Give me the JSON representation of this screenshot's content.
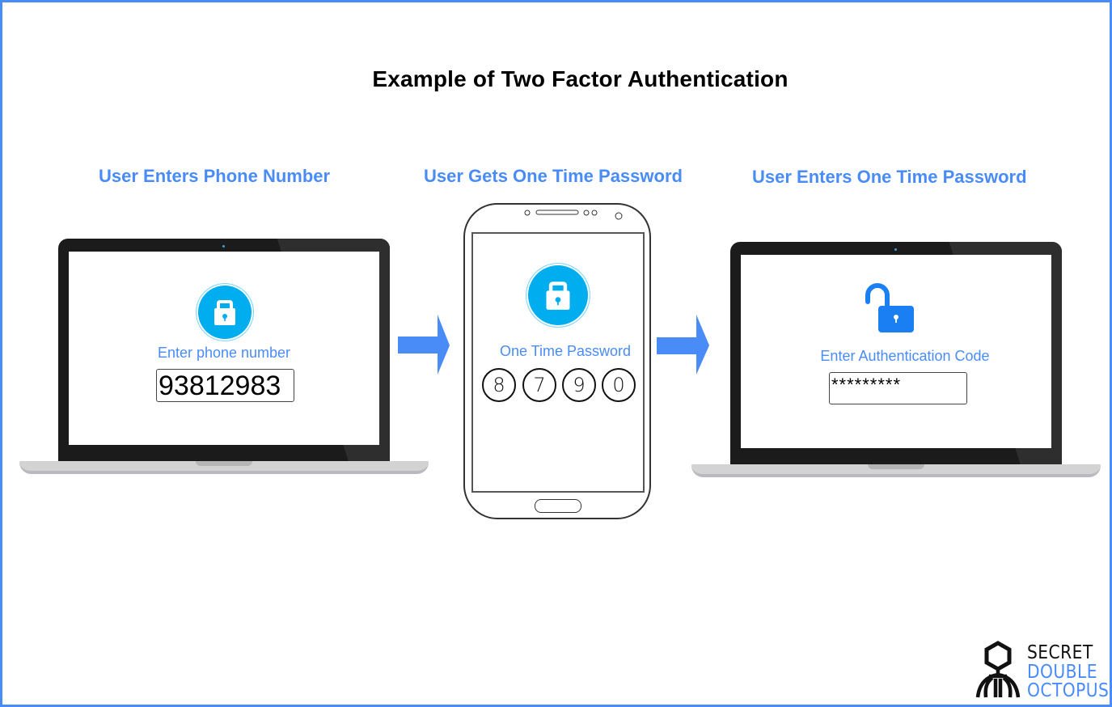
{
  "title": "Example of Two Factor Authentication",
  "colors": {
    "accent": "#4a8cf7",
    "lock_circle": "#00aeef",
    "border": "#4a8cf7",
    "open_lock": "#1a7ff2"
  },
  "steps": [
    {
      "heading": "User Enters  Phone Number",
      "device": "laptop",
      "icon": "lock-icon",
      "label": "Enter phone number",
      "input_value": "93812983"
    },
    {
      "heading": "User Gets One Time Password",
      "device": "phone",
      "icon": "lock-icon",
      "label": "One Time Password",
      "otp_digits": [
        "8",
        "7",
        "9",
        "0"
      ]
    },
    {
      "heading": "User Enters One Time Password",
      "device": "laptop",
      "icon": "unlocked-lock-icon",
      "label": "Enter Authentication Code",
      "input_value": "*********"
    }
  ],
  "arrows": [
    "arrow-right-icon",
    "arrow-right-icon"
  ],
  "logo": {
    "line1": "SECRET",
    "line2": "DOUBLE",
    "line3": "OCTOPUS"
  }
}
